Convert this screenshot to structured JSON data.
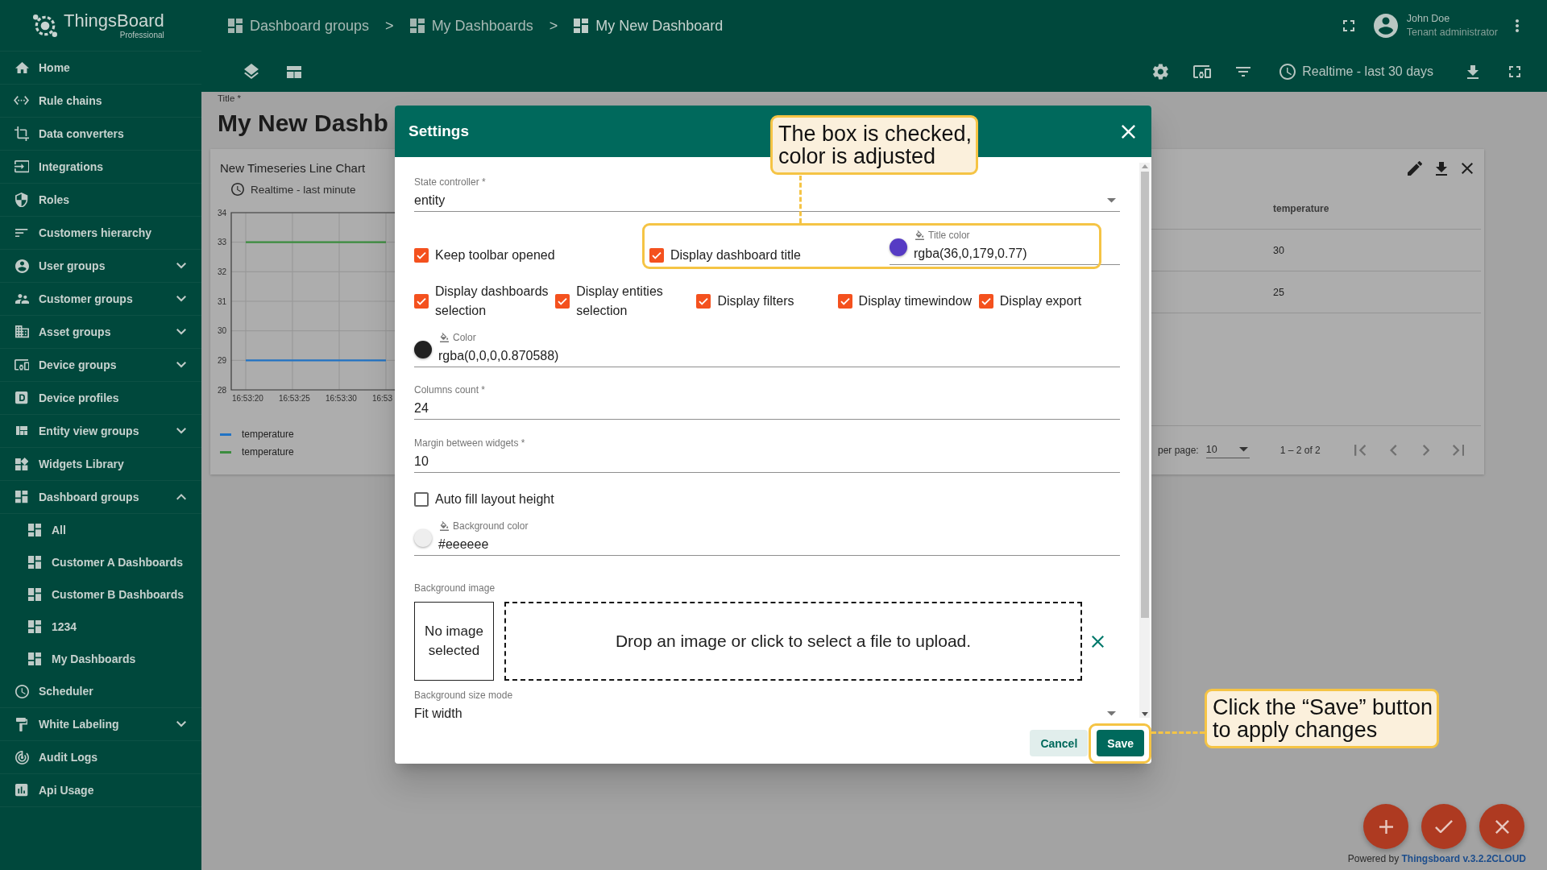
{
  "sidebar": {
    "logo": {
      "name": "ThingsBoard",
      "edition": "Professional"
    },
    "items": [
      {
        "label": "Home"
      },
      {
        "label": "Rule chains"
      },
      {
        "label": "Data converters"
      },
      {
        "label": "Integrations"
      },
      {
        "label": "Roles"
      },
      {
        "label": "Customers hierarchy"
      },
      {
        "label": "User groups",
        "expanded": false
      },
      {
        "label": "Customer groups",
        "expanded": false
      },
      {
        "label": "Asset groups",
        "expanded": false
      },
      {
        "label": "Device groups",
        "expanded": false
      },
      {
        "label": "Device profiles"
      },
      {
        "label": "Entity view groups",
        "expanded": false
      },
      {
        "label": "Widgets Library"
      },
      {
        "label": "Dashboard groups",
        "expanded": true,
        "children": [
          {
            "label": "All"
          },
          {
            "label": "Customer A Dashboards"
          },
          {
            "label": "Customer B Dashboards"
          },
          {
            "label": "1234"
          },
          {
            "label": "My Dashboards"
          }
        ]
      },
      {
        "label": "Scheduler"
      },
      {
        "label": "White Labeling",
        "expanded": false
      },
      {
        "label": "Audit Logs"
      },
      {
        "label": "Api Usage"
      }
    ]
  },
  "header": {
    "breadcrumbs": [
      {
        "label": "Dashboard groups",
        "separator": ">"
      },
      {
        "label": "My Dashboards",
        "separator": ">"
      },
      {
        "label": "My New Dashboard"
      }
    ],
    "user": {
      "name": "John Doe",
      "role": "Tenant administrator"
    },
    "timewindow": "Realtime - last 30 days"
  },
  "dashboard": {
    "title_label": "Title *",
    "title": "My New Dashb",
    "chart_widget": {
      "title": "New Timeseries Line Chart",
      "timewindow": "Realtime - last minute",
      "chart_data": {
        "type": "line",
        "categories": [
          "16:53:20",
          "16:53:25",
          "16:53:30",
          "16:53"
        ],
        "ylim": [
          28,
          34
        ],
        "yticks": [
          28,
          29,
          30,
          31,
          32,
          33,
          34
        ],
        "grid": true,
        "series": [
          {
            "name": "temperature",
            "color": "#2173c4",
            "values": [
              29,
              29,
              29,
              29
            ]
          },
          {
            "name": "temperature",
            "color": "#3b8c3e",
            "values": [
              33,
              33,
              33,
              33
            ]
          }
        ]
      }
    },
    "table_widget": {
      "columns": [
        "temperature"
      ],
      "rows": [
        [
          "30"
        ],
        [
          "25"
        ]
      ],
      "page_size_label": "per page:",
      "page_size": "10",
      "range": "1 – 2 of 2"
    }
  },
  "dialog": {
    "title": "Settings",
    "rows": [
      {
        "items": [
          {
            "kind": "select",
            "label": "State controller *",
            "value": "entity"
          }
        ]
      },
      {
        "items": [
          {
            "kind": "checkbox",
            "label": "Keep toolbar opened",
            "checked": true
          },
          {
            "kind": "checkbox",
            "label": "Display dashboard title",
            "checked": true
          },
          {
            "kind": "color",
            "label": "Title color",
            "value": "rgba(36,0,179,0.77)",
            "color": "#563bc4"
          }
        ]
      },
      {
        "items": [
          {
            "kind": "checkbox",
            "label": "Display dashboards selection",
            "checked": true
          },
          {
            "kind": "checkbox",
            "label": "Display entities selection",
            "checked": true
          },
          {
            "kind": "checkbox",
            "label": "Display filters",
            "checked": true
          },
          {
            "kind": "checkbox",
            "label": "Display timewindow",
            "checked": true
          },
          {
            "kind": "checkbox",
            "label": "Display export",
            "checked": true
          }
        ]
      },
      {
        "items": [
          {
            "kind": "color",
            "label": "Color",
            "value": "rgba(0,0,0,0.870588)",
            "color": "#212121"
          }
        ]
      },
      {
        "items": [
          {
            "kind": "text",
            "label": "Columns count *",
            "value": "24"
          }
        ]
      },
      {
        "items": [
          {
            "kind": "text",
            "label": "Margin between widgets *",
            "value": "10"
          }
        ]
      },
      {
        "items": [
          {
            "kind": "checkbox",
            "label": "Auto fill layout height",
            "checked": false
          }
        ]
      },
      {
        "items": [
          {
            "kind": "color",
            "label": "Background color",
            "value": "#eeeeee",
            "color": "#eeeeee"
          }
        ]
      },
      {
        "items": [
          {
            "kind": "image",
            "label": "Background image",
            "preview": "No image selected",
            "drop_text": "Drop an image or click to select a file to upload."
          }
        ]
      },
      {
        "items": [
          {
            "kind": "select",
            "label": "Background size mode",
            "value": "Fit width"
          }
        ]
      }
    ],
    "actions": [
      {
        "label": "Cancel",
        "kind": "secondary"
      },
      {
        "label": "Save",
        "kind": "primary"
      }
    ]
  },
  "annotations": [
    {
      "text": "The box is checked,\ncolor is adjusted"
    },
    {
      "text": "Click the “Save” button\nto apply changes"
    }
  ],
  "footer": {
    "text": "Powered by",
    "link": "Thingsboard v.3.2.2CLOUD"
  }
}
